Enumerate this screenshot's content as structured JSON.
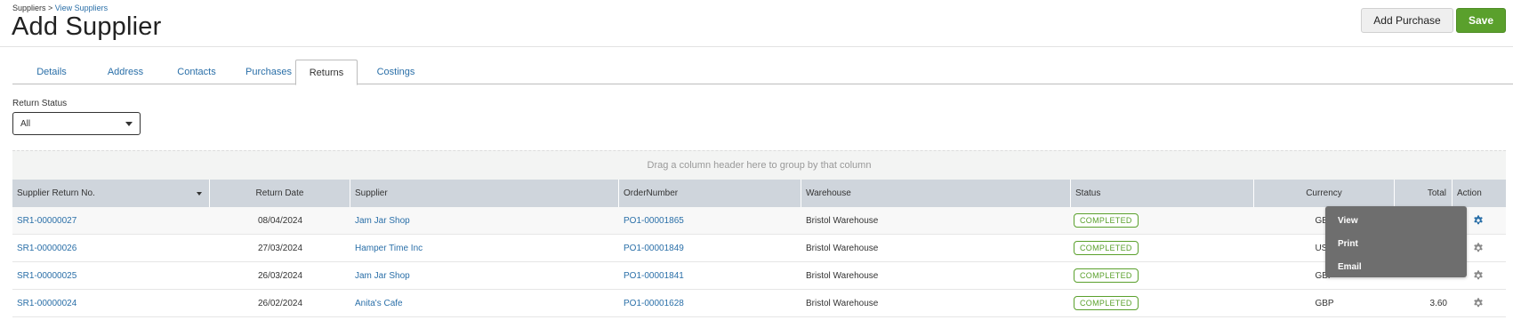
{
  "breadcrumb": {
    "root": "Suppliers",
    "separator": " > ",
    "current": "View Suppliers"
  },
  "page": {
    "title": "Add Supplier"
  },
  "toolbar": {
    "add_purchase_label": "Add Purchase",
    "save_label": "Save"
  },
  "tabs": [
    {
      "label": "Details",
      "active": false
    },
    {
      "label": "Address",
      "active": false
    },
    {
      "label": "Contacts",
      "active": false
    },
    {
      "label": "Purchases",
      "active": false
    },
    {
      "label": "Returns",
      "active": true
    },
    {
      "label": "Costings",
      "active": false
    }
  ],
  "filter": {
    "label": "Return Status",
    "value": "All"
  },
  "grid": {
    "group_hint": "Drag a column header here to group by that column",
    "columns": [
      "Supplier Return No.",
      "Return Date",
      "Supplier",
      "OrderNumber",
      "Warehouse",
      "Status",
      "Currency",
      "Total",
      "Action"
    ],
    "rows": [
      {
        "return_no": "SR1-00000027",
        "return_date": "08/04/2024",
        "supplier": "Jam Jar Shop",
        "order_number": "PO1-00001865",
        "warehouse": "Bristol Warehouse",
        "status": "COMPLETED",
        "currency": "GBP",
        "total": ""
      },
      {
        "return_no": "SR1-00000026",
        "return_date": "27/03/2024",
        "supplier": "Hamper Time Inc",
        "order_number": "PO1-00001849",
        "warehouse": "Bristol Warehouse",
        "status": "COMPLETED",
        "currency": "USD",
        "total": ""
      },
      {
        "return_no": "SR1-00000025",
        "return_date": "26/03/2024",
        "supplier": "Jam Jar Shop",
        "order_number": "PO1-00001841",
        "warehouse": "Bristol Warehouse",
        "status": "COMPLETED",
        "currency": "GBP",
        "total": ""
      },
      {
        "return_no": "SR1-00000024",
        "return_date": "26/02/2024",
        "supplier": "Anita's Cafe",
        "order_number": "PO1-00001628",
        "warehouse": "Bristol Warehouse",
        "status": "COMPLETED",
        "currency": "GBP",
        "total": "3.60"
      }
    ]
  },
  "action_menu": {
    "items": [
      "View",
      "Print",
      "Email"
    ]
  },
  "colors": {
    "accent": "#2a6fa8",
    "save_green": "#5aa02c",
    "header_bg": "#cfd5dc",
    "menu_bg": "#6e6e6e"
  },
  "icons": {
    "row_action": "gear-icon",
    "sort": "chevron-down-icon"
  }
}
